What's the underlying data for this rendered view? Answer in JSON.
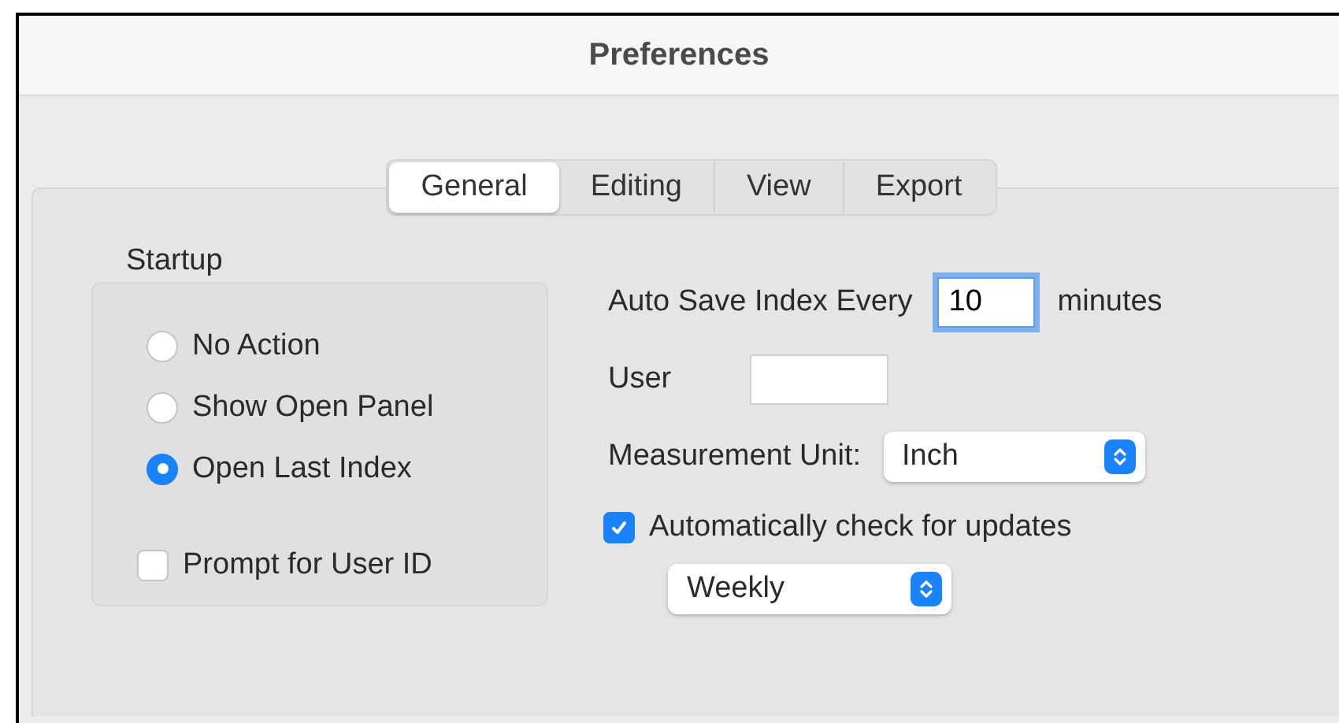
{
  "window": {
    "title": "Preferences"
  },
  "tabs": [
    {
      "label": "General",
      "selected": true
    },
    {
      "label": "Editing",
      "selected": false
    },
    {
      "label": "View",
      "selected": false
    },
    {
      "label": "Export",
      "selected": false
    }
  ],
  "startup": {
    "title": "Startup",
    "options": [
      {
        "label": "No Action",
        "selected": false
      },
      {
        "label": "Show Open Panel",
        "selected": false
      },
      {
        "label": "Open Last Index",
        "selected": true
      }
    ],
    "prompt": {
      "label": "Prompt for User ID",
      "checked": false
    }
  },
  "settings": {
    "autosave": {
      "label": "Auto Save Index Every",
      "value": "10",
      "unit": "minutes",
      "focused": true
    },
    "user": {
      "label": "User"
    },
    "unit": {
      "label": "Measurement Unit:",
      "value": "Inch"
    },
    "updates": {
      "label": "Automatically check for updates",
      "checked": true,
      "frequency": "Weekly"
    }
  }
}
